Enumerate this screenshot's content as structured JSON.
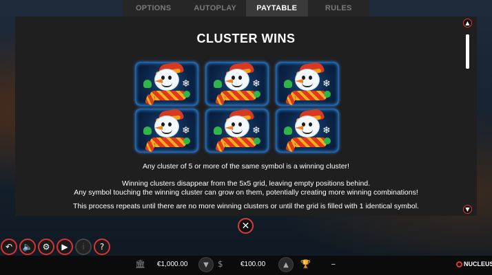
{
  "tabs": [
    {
      "label": "OPTIONS",
      "active": false
    },
    {
      "label": "AUTOPLAY",
      "active": false
    },
    {
      "label": "PAYTABLE",
      "active": true
    },
    {
      "label": "RULES",
      "active": false
    }
  ],
  "panel": {
    "title": "CLUSTER WINS",
    "symbol_icon": "snowman-symbol",
    "symbol_count": 6,
    "paragraphs": [
      "Any cluster of 5 or more of the same symbol is a winning cluster!",
      "Winning clusters disappear from the 5x5 grid, leaving empty positions behind.",
      "Any symbol touching the winning cluster can grow on them, potentially creating more winning combinations!",
      "This process repeats until there are no more winning clusters or until the grid is filled with 1 identical symbol."
    ]
  },
  "controls": {
    "back_icon": "back-arrow-icon",
    "sound_icon": "speaker-icon",
    "settings_icon": "gear-icon",
    "play_icon": "play-icon",
    "info_icon": "info-icon",
    "help_icon": "question-icon"
  },
  "bottom_bar": {
    "balance": "€1,000.00",
    "bet": "€100.00",
    "win": "–",
    "brand": "NUCLEUS"
  },
  "colors": {
    "accent": "#e03a3a",
    "panel_bg": "#1f1f1f",
    "tab_active_bg": "#3a3a3a"
  }
}
